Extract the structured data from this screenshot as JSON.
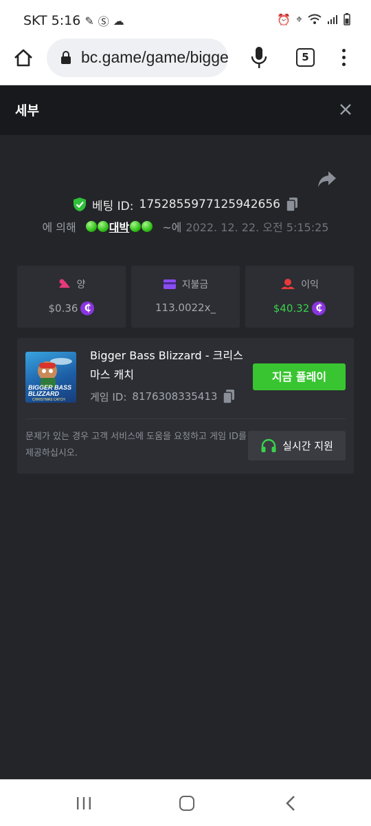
{
  "status_bar": {
    "carrier": "SKT",
    "time": "5:16"
  },
  "browser": {
    "url": "bc.game/game/bigger-bass-blizzard",
    "tab_count": "5"
  },
  "dialog": {
    "title": "세부",
    "bet_id_label": "베팅 ID:",
    "bet_id": "1752855977125942656",
    "by_label": "에 의해",
    "username": "대박",
    "at_label": "~에",
    "datetime": "2022. 12. 22. 오전 5:15:25",
    "stats": [
      {
        "label": "양",
        "value": "$0.36",
        "has_coin": true,
        "color": "#e8397a"
      },
      {
        "label": "지불금",
        "value": "113.0022x_",
        "has_coin": false,
        "color": "#8a4cf0"
      },
      {
        "label": "이익",
        "value": "$40.32",
        "has_coin": true,
        "color": "#e83a3a"
      }
    ],
    "game": {
      "title": "Bigger Bass Blizzard - 크리스마스 캐치",
      "id_label": "게임 ID:",
      "id": "8176308335413",
      "play_label": "지금 플레이",
      "thumb_text_1": "BIGGER BASS",
      "thumb_text_2": "BLIZZARD",
      "thumb_text_3": "CHRISTMAS CATCH"
    },
    "help_text": "문제가 있는 경우 고객 서비스에 도움을 요청하고 게임 ID를 제공하십시오.",
    "support_label": "실시간 지원"
  },
  "colors": {
    "accent_green": "#38c531",
    "coin_purple": "#8a35e0",
    "background": "#232529"
  }
}
